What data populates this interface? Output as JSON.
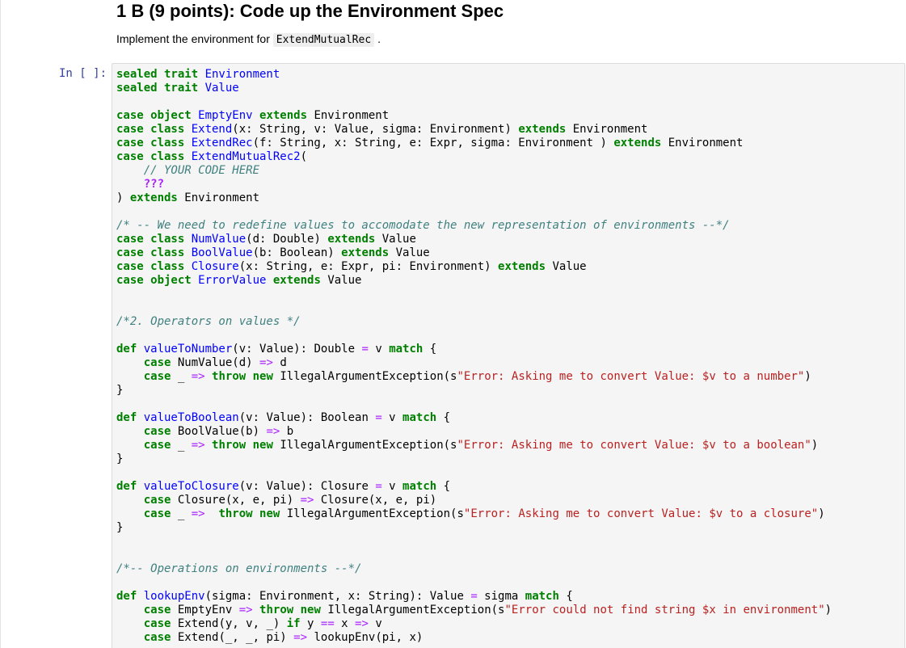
{
  "markdown": {
    "title": "1 B (9 points): Code up the Environment Spec",
    "intro_text": "Implement the environment for",
    "intro_code": "ExtendMutualRec",
    "intro_end": "."
  },
  "cell": {
    "prompt": "In [ ]:"
  },
  "code_lines": [
    [
      [
        "kw",
        "sealed trait "
      ],
      [
        "ty",
        "Environment"
      ]
    ],
    [
      [
        "kw",
        "sealed trait "
      ],
      [
        "ty",
        "Value"
      ]
    ],
    [],
    [
      [
        "kw",
        "case object "
      ],
      [
        "ty",
        "EmptyEnv "
      ],
      [
        "kw",
        "extends "
      ],
      [
        "",
        "Environment"
      ]
    ],
    [
      [
        "kw",
        "case class "
      ],
      [
        "ty",
        "Extend"
      ],
      [
        "",
        "(x: String, v: Value, sigma: Environment) "
      ],
      [
        "kw",
        "extends "
      ],
      [
        "",
        "Environment"
      ]
    ],
    [
      [
        "kw",
        "case class "
      ],
      [
        "ty",
        "ExtendRec"
      ],
      [
        "",
        "(f: String, x: String, e: Expr, sigma: Environment ) "
      ],
      [
        "kw",
        "extends "
      ],
      [
        "",
        "Environment"
      ]
    ],
    [
      [
        "kw",
        "case class "
      ],
      [
        "ty",
        "ExtendMutualRec2"
      ],
      [
        "",
        "("
      ]
    ],
    [
      [
        "",
        "    "
      ],
      [
        "cm",
        "// YOUR CODE HERE"
      ]
    ],
    [
      [
        "",
        "    "
      ],
      [
        "qm",
        "???"
      ]
    ],
    [
      [
        "",
        ") "
      ],
      [
        "kw",
        "extends "
      ],
      [
        "",
        "Environment"
      ]
    ],
    [],
    [
      [
        "cm",
        "/* -- We need to redefine values to accomodate the new representation of environments --*/"
      ]
    ],
    [
      [
        "kw",
        "case class "
      ],
      [
        "ty",
        "NumValue"
      ],
      [
        "",
        "(d: Double) "
      ],
      [
        "kw",
        "extends "
      ],
      [
        "",
        "Value"
      ]
    ],
    [
      [
        "kw",
        "case class "
      ],
      [
        "ty",
        "BoolValue"
      ],
      [
        "",
        "(b: Boolean) "
      ],
      [
        "kw",
        "extends "
      ],
      [
        "",
        "Value"
      ]
    ],
    [
      [
        "kw",
        "case class "
      ],
      [
        "ty",
        "Closure"
      ],
      [
        "",
        "(x: String, e: Expr, pi: Environment) "
      ],
      [
        "kw",
        "extends "
      ],
      [
        "",
        "Value"
      ]
    ],
    [
      [
        "kw",
        "case object "
      ],
      [
        "ty",
        "ErrorValue "
      ],
      [
        "kw",
        "extends "
      ],
      [
        "",
        "Value"
      ]
    ],
    [],
    [],
    [
      [
        "cm",
        "/*2. Operators on values */"
      ]
    ],
    [],
    [
      [
        "kw",
        "def "
      ],
      [
        "fn",
        "valueToNumber"
      ],
      [
        "",
        "(v: Value): Double "
      ],
      [
        "op",
        "="
      ],
      [
        "",
        " v "
      ],
      [
        "kw",
        "match "
      ],
      [
        "",
        "{"
      ]
    ],
    [
      [
        "",
        "    "
      ],
      [
        "kw",
        "case "
      ],
      [
        "",
        "NumValue(d) "
      ],
      [
        "op",
        "=>"
      ],
      [
        "",
        " d"
      ]
    ],
    [
      [
        "",
        "    "
      ],
      [
        "kw",
        "case "
      ],
      [
        "",
        "_ "
      ],
      [
        "op",
        "=>"
      ],
      [
        "",
        " "
      ],
      [
        "kw",
        "throw new "
      ],
      [
        "",
        "IllegalArgumentException(s"
      ],
      [
        "st",
        "\"Error: Asking me to convert Value: $v to a number\""
      ],
      [
        "",
        ")"
      ]
    ],
    [
      [
        "",
        "}"
      ]
    ],
    [],
    [
      [
        "kw",
        "def "
      ],
      [
        "fn",
        "valueToBoolean"
      ],
      [
        "",
        "(v: Value): Boolean "
      ],
      [
        "op",
        "="
      ],
      [
        "",
        " v "
      ],
      [
        "kw",
        "match "
      ],
      [
        "",
        "{"
      ]
    ],
    [
      [
        "",
        "    "
      ],
      [
        "kw",
        "case "
      ],
      [
        "",
        "BoolValue(b) "
      ],
      [
        "op",
        "=>"
      ],
      [
        "",
        " b"
      ]
    ],
    [
      [
        "",
        "    "
      ],
      [
        "kw",
        "case "
      ],
      [
        "",
        "_ "
      ],
      [
        "op",
        "=>"
      ],
      [
        "",
        " "
      ],
      [
        "kw",
        "throw new "
      ],
      [
        "",
        "IllegalArgumentException(s"
      ],
      [
        "st",
        "\"Error: Asking me to convert Value: $v to a boolean\""
      ],
      [
        "",
        ")"
      ]
    ],
    [
      [
        "",
        "}"
      ]
    ],
    [],
    [
      [
        "kw",
        "def "
      ],
      [
        "fn",
        "valueToClosure"
      ],
      [
        "",
        "(v: Value): Closure "
      ],
      [
        "op",
        "="
      ],
      [
        "",
        " v "
      ],
      [
        "kw",
        "match "
      ],
      [
        "",
        "{"
      ]
    ],
    [
      [
        "",
        "    "
      ],
      [
        "kw",
        "case "
      ],
      [
        "",
        "Closure(x, e, pi) "
      ],
      [
        "op",
        "=>"
      ],
      [
        "",
        " Closure(x, e, pi)"
      ]
    ],
    [
      [
        "",
        "    "
      ],
      [
        "kw",
        "case "
      ],
      [
        "",
        "_ "
      ],
      [
        "op",
        "=>"
      ],
      [
        "",
        "  "
      ],
      [
        "kw",
        "throw new "
      ],
      [
        "",
        "IllegalArgumentException(s"
      ],
      [
        "st",
        "\"Error: Asking me to convert Value: $v to a closure\""
      ],
      [
        "",
        ")"
      ]
    ],
    [
      [
        "",
        "}"
      ]
    ],
    [],
    [],
    [
      [
        "cm",
        "/*-- Operations on environments --*/"
      ]
    ],
    [],
    [
      [
        "kw",
        "def "
      ],
      [
        "fn",
        "lookupEnv"
      ],
      [
        "",
        "(sigma: Environment, x: String): Value "
      ],
      [
        "op",
        "="
      ],
      [
        "",
        " sigma "
      ],
      [
        "kw",
        "match "
      ],
      [
        "",
        "{"
      ]
    ],
    [
      [
        "",
        "    "
      ],
      [
        "kw",
        "case "
      ],
      [
        "",
        "EmptyEnv "
      ],
      [
        "op",
        "=>"
      ],
      [
        "",
        " "
      ],
      [
        "kw",
        "throw new "
      ],
      [
        "",
        "IllegalArgumentException(s"
      ],
      [
        "st",
        "\"Error could not find string $x in environment\""
      ],
      [
        "",
        ")"
      ]
    ],
    [
      [
        "",
        "    "
      ],
      [
        "kw",
        "case "
      ],
      [
        "",
        "Extend(y, v, _) "
      ],
      [
        "kw",
        "if "
      ],
      [
        "",
        "y "
      ],
      [
        "op",
        "=="
      ],
      [
        "",
        " x "
      ],
      [
        "op",
        "=>"
      ],
      [
        "",
        " v"
      ]
    ],
    [
      [
        "",
        "    "
      ],
      [
        "kw",
        "case "
      ],
      [
        "",
        "Extend(_, _, pi) "
      ],
      [
        "op",
        "=>"
      ],
      [
        "",
        " lookupEnv(pi, x)"
      ]
    ]
  ]
}
